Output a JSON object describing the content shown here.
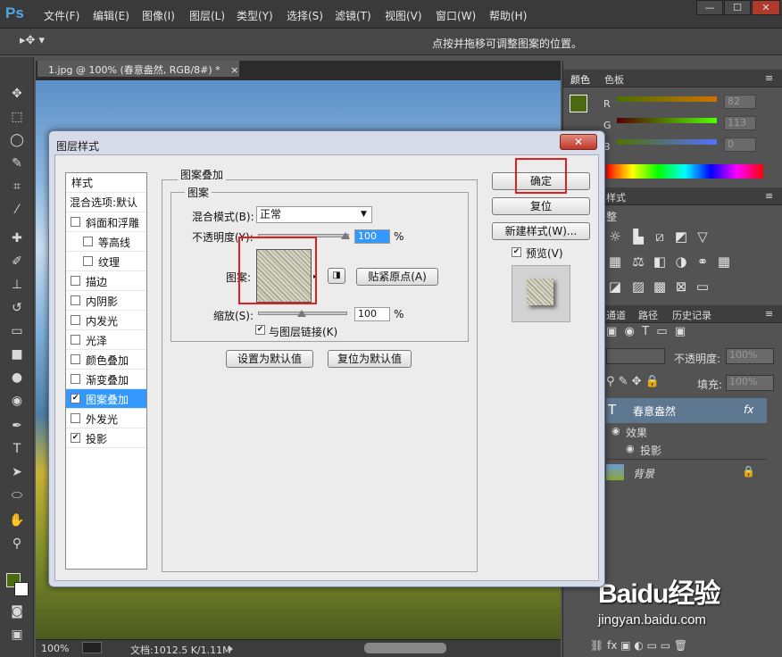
{
  "app": {
    "logo": "Ps",
    "menu": [
      "文件(F)",
      "编辑(E)",
      "图像(I)",
      "图层(L)",
      "类型(Y)",
      "选择(S)",
      "滤镜(T)",
      "视图(V)",
      "窗口(W)",
      "帮助(H)"
    ],
    "window_buttons": [
      "—",
      "☐",
      "✕"
    ]
  },
  "options_bar": {
    "hint": "点按并拖移可调整图案的位置。"
  },
  "document": {
    "tab_title": "1.jpg @ 100% (春意盎然, RGB/8#) *",
    "tab_close": "×",
    "status_zoom": "100%",
    "status_doc": "文档:1012.5 K/1.11M"
  },
  "colors": {
    "foreground": "#4a6a10",
    "background": "#ffffff",
    "accent_red": "#e02020",
    "selection_blue": "#3399ff"
  },
  "right_panel": {
    "color_tabs": [
      "颜色",
      "色板"
    ],
    "rgb": [
      {
        "label": "R",
        "value": "82"
      },
      {
        "label": "G",
        "value": "113"
      },
      {
        "label": "B",
        "value": "0"
      }
    ],
    "adjust_tab_frag": "样式",
    "adjust_label_frag": "整",
    "layer_tabs": [
      "通道",
      "路径",
      "历史记录"
    ],
    "opacity_label": "不透明度:",
    "opacity_value": "100%",
    "fill_label": "填充:",
    "fill_value": "100%",
    "layers": [
      {
        "name": "春意盎然",
        "kind": "text",
        "fx": "fx"
      },
      {
        "name": "效果",
        "kind": "effects"
      },
      {
        "name": "投影",
        "kind": "effect"
      },
      {
        "name": "背景",
        "kind": "image"
      }
    ]
  },
  "dialog": {
    "title": "图层样式",
    "close": "✕",
    "style_list": {
      "header": "样式",
      "blend_options": "混合选项:默认",
      "items": [
        {
          "label": "斜面和浮雕",
          "checked": false,
          "indent": false
        },
        {
          "label": "等高线",
          "checked": false,
          "indent": true
        },
        {
          "label": "纹理",
          "checked": false,
          "indent": true
        },
        {
          "label": "描边",
          "checked": false,
          "indent": false
        },
        {
          "label": "内阴影",
          "checked": false,
          "indent": false
        },
        {
          "label": "内发光",
          "checked": false,
          "indent": false
        },
        {
          "label": "光泽",
          "checked": false,
          "indent": false
        },
        {
          "label": "颜色叠加",
          "checked": false,
          "indent": false
        },
        {
          "label": "渐变叠加",
          "checked": false,
          "indent": false
        },
        {
          "label": "图案叠加",
          "checked": true,
          "indent": false,
          "selected": true
        },
        {
          "label": "外发光",
          "checked": false,
          "indent": false
        },
        {
          "label": "投影",
          "checked": true,
          "indent": false
        }
      ]
    },
    "group_title": "图案叠加",
    "subgroup_title": "图案",
    "blend_mode_label": "混合模式(B):",
    "blend_mode_value": "正常",
    "opacity_label": "不透明度(Y):",
    "opacity_value": "100",
    "opacity_unit": "%",
    "opacity_level": 1.0,
    "pattern_label": "图案:",
    "snap_button": "贴紧原点(A)",
    "scale_label": "缩放(S):",
    "scale_value": "100",
    "scale_unit": "%",
    "scale_level": 0.5,
    "link_label": "与图层链接(K)",
    "link_checked": true,
    "set_default": "设置为默认值",
    "reset_default": "复位为默认值",
    "ok": "确定",
    "reset": "复位",
    "new_style": "新建样式(W)...",
    "preview_label": "预览(V)",
    "preview_checked": true
  },
  "watermark": {
    "brand": "Baidu经验",
    "url": "jingyan.baidu.com"
  }
}
